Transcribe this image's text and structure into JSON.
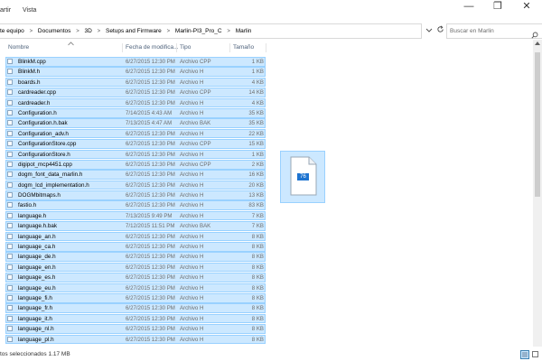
{
  "ribbon": {
    "tab_share": "artir",
    "tab_view": "Vista"
  },
  "window_controls": {
    "minimize": "—",
    "maximize": "❐",
    "close": "✕"
  },
  "address": {
    "crumbs": [
      "te equipo",
      "Documentos",
      "3D",
      "Setups and Firmware",
      "Marlin-PI3_Pro_C",
      "Marlin"
    ],
    "separator": ">"
  },
  "search": {
    "placeholder": "Buscar en Marlin"
  },
  "columns": {
    "name": "Nombre",
    "date": "Fecha de modifica...",
    "type": "Tipo",
    "size": "Tamaño"
  },
  "files": [
    {
      "name": "BlinkM.cpp",
      "date": "6/27/2015 12:30 PM",
      "type": "Archivo CPP",
      "size": "1 KB"
    },
    {
      "name": "BlinkM.h",
      "date": "6/27/2015 12:30 PM",
      "type": "Archivo H",
      "size": "1 KB"
    },
    {
      "name": "boards.h",
      "date": "6/27/2015 12:30 PM",
      "type": "Archivo H",
      "size": "4 KB"
    },
    {
      "name": "cardreader.cpp",
      "date": "6/27/2015 12:30 PM",
      "type": "Archivo CPP",
      "size": "14 KB"
    },
    {
      "name": "cardreader.h",
      "date": "6/27/2015 12:30 PM",
      "type": "Archivo H",
      "size": "4 KB"
    },
    {
      "name": "Configuration.h",
      "date": "7/14/2015 4:43 AM",
      "type": "Archivo H",
      "size": "35 KB"
    },
    {
      "name": "Configuration.h.bak",
      "date": "7/13/2015 4:47 AM",
      "type": "Archivo BAK",
      "size": "35 KB"
    },
    {
      "name": "Configuration_adv.h",
      "date": "6/27/2015 12:30 PM",
      "type": "Archivo H",
      "size": "22 KB"
    },
    {
      "name": "ConfigurationStore.cpp",
      "date": "6/27/2015 12:30 PM",
      "type": "Archivo CPP",
      "size": "15 KB"
    },
    {
      "name": "ConfigurationStore.h",
      "date": "6/27/2015 12:30 PM",
      "type": "Archivo H",
      "size": "1 KB"
    },
    {
      "name": "digipot_mcp4451.cpp",
      "date": "6/27/2015 12:30 PM",
      "type": "Archivo CPP",
      "size": "2 KB"
    },
    {
      "name": "dogm_font_data_marlin.h",
      "date": "6/27/2015 12:30 PM",
      "type": "Archivo H",
      "size": "16 KB"
    },
    {
      "name": "dogm_lcd_implementation.h",
      "date": "6/27/2015 12:30 PM",
      "type": "Archivo H",
      "size": "20 KB"
    },
    {
      "name": "DOGMbitmaps.h",
      "date": "6/27/2015 12:30 PM",
      "type": "Archivo H",
      "size": "13 KB"
    },
    {
      "name": "fastio.h",
      "date": "6/27/2015 12:30 PM",
      "type": "Archivo H",
      "size": "83 KB"
    },
    {
      "name": "language.h",
      "date": "7/13/2015 9:49 PM",
      "type": "Archivo H",
      "size": "7 KB"
    },
    {
      "name": "language.h.bak",
      "date": "7/12/2015 11:51 PM",
      "type": "Archivo BAK",
      "size": "7 KB"
    },
    {
      "name": "language_an.h",
      "date": "6/27/2015 12:30 PM",
      "type": "Archivo H",
      "size": "8 KB"
    },
    {
      "name": "language_ca.h",
      "date": "6/27/2015 12:30 PM",
      "type": "Archivo H",
      "size": "8 KB"
    },
    {
      "name": "language_de.h",
      "date": "6/27/2015 12:30 PM",
      "type": "Archivo H",
      "size": "8 KB"
    },
    {
      "name": "language_en.h",
      "date": "6/27/2015 12:30 PM",
      "type": "Archivo H",
      "size": "8 KB"
    },
    {
      "name": "language_es.h",
      "date": "6/27/2015 12:30 PM",
      "type": "Archivo H",
      "size": "8 KB"
    },
    {
      "name": "language_eu.h",
      "date": "6/27/2015 12:30 PM",
      "type": "Archivo H",
      "size": "8 KB"
    },
    {
      "name": "language_fi.h",
      "date": "6/27/2015 12:30 PM",
      "type": "Archivo H",
      "size": "8 KB"
    },
    {
      "name": "language_fr.h",
      "date": "6/27/2015 12:30 PM",
      "type": "Archivo H",
      "size": "8 KB"
    },
    {
      "name": "language_it.h",
      "date": "6/27/2015 12:30 PM",
      "type": "Archivo H",
      "size": "8 KB"
    },
    {
      "name": "language_nl.h",
      "date": "6/27/2015 12:30 PM",
      "type": "Archivo H",
      "size": "8 KB"
    },
    {
      "name": "language_pl.h",
      "date": "6/27/2015 12:30 PM",
      "type": "Archivo H",
      "size": "8 KB"
    }
  ],
  "drag": {
    "count": "76"
  },
  "status": {
    "selection": "tos seleccionados  1.17 MB"
  },
  "colors": {
    "selection_fill": "#cce8ff",
    "selection_border": "#99d1ff",
    "header_text": "#4c607a",
    "drag_badge": "#1e74d0"
  }
}
